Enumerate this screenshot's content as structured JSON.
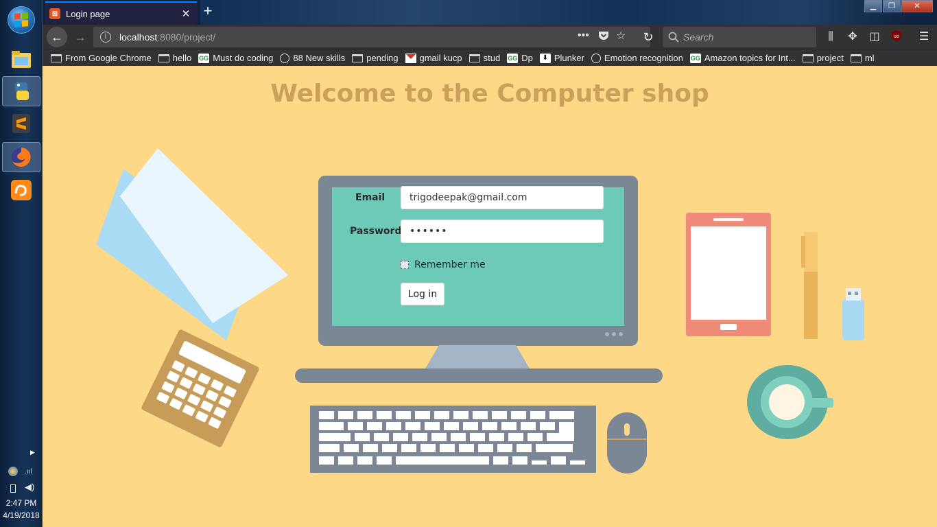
{
  "taskbar": {
    "time": "2:47 PM",
    "date": "4/19/2018",
    "apps": [
      "file-explorer",
      "python",
      "sublime-text",
      "firefox",
      "uc-browser"
    ]
  },
  "browser": {
    "tab_title": "Login page",
    "url_host": "localhost",
    "url_path": ":8080/project/",
    "search_placeholder": "Search"
  },
  "bookmarks": [
    {
      "label": "From Google Chrome",
      "icon": "folder"
    },
    {
      "label": "hello",
      "icon": "folder"
    },
    {
      "label": "Must do coding",
      "icon": "gfg"
    },
    {
      "label": "88 New skills",
      "icon": "globe"
    },
    {
      "label": "pending",
      "icon": "folder"
    },
    {
      "label": "gmail kucp",
      "icon": "gmail"
    },
    {
      "label": "stud",
      "icon": "folder"
    },
    {
      "label": "Dp",
      "icon": "gfg"
    },
    {
      "label": "Plunker",
      "icon": "plunker"
    },
    {
      "label": "Emotion recognition",
      "icon": "globe"
    },
    {
      "label": "Amazon topics for Int...",
      "icon": "gfg"
    },
    {
      "label": "project",
      "icon": "folder"
    },
    {
      "label": "ml",
      "icon": "folder"
    }
  ],
  "page": {
    "title": "Welcome to the Computer shop",
    "form": {
      "email_label": "Email",
      "email_value": "trigodeepak@gmail.com",
      "password_label": "Password",
      "password_value": "••••••",
      "remember_label": "Remember me",
      "login_label": "Log in"
    }
  },
  "colors": {
    "page_bg": "#fdd887",
    "title": "#c9a15a",
    "screen": "#6dcab7",
    "device": "#7b8794"
  }
}
